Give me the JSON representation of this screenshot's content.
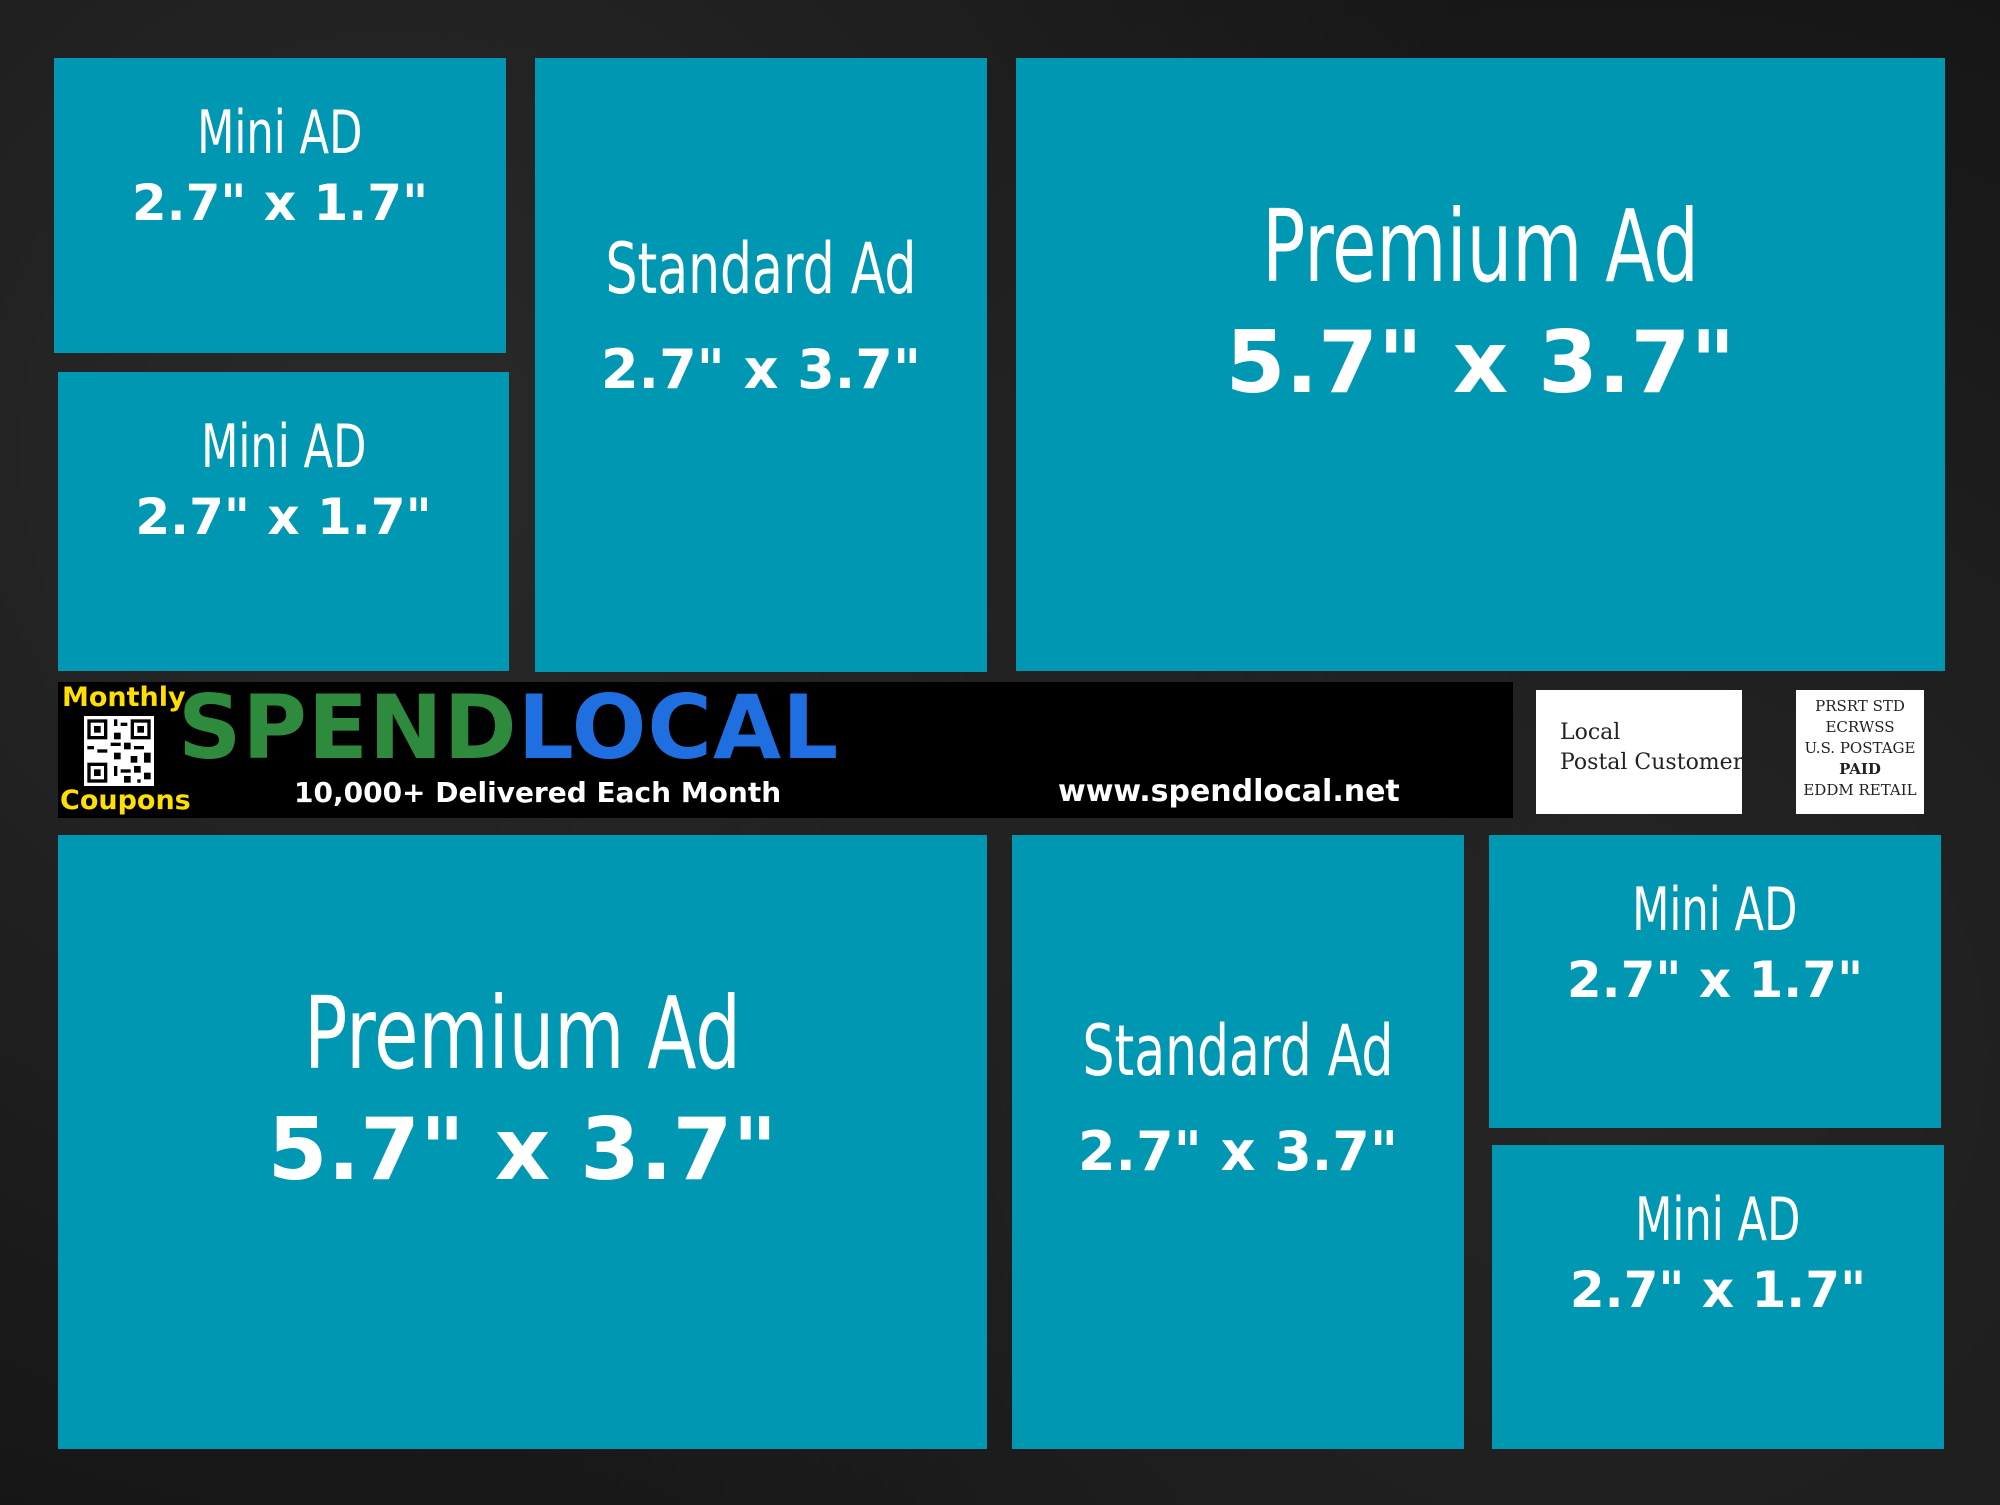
{
  "ads": {
    "mini_top_left": {
      "title": "Mini AD",
      "size": "2.7\" x 1.7\""
    },
    "mini_mid_left": {
      "title": "Mini AD",
      "size": "2.7\" x 1.7\""
    },
    "standard_top": {
      "title": "Standard Ad",
      "size": "2.7\" x 3.7\""
    },
    "premium_top": {
      "title": "Premium Ad",
      "size": "5.7\" x 3.7\""
    },
    "premium_bottom": {
      "title": "Premium Ad",
      "size": "5.7\" x 3.7\""
    },
    "standard_bottom": {
      "title": "Standard Ad",
      "size": "2.7\" x 3.7\""
    },
    "mini_bottom_right_top": {
      "title": "Mini AD",
      "size": "2.7\" x 1.7\""
    },
    "mini_bottom_right_bottom": {
      "title": "Mini AD",
      "size": "2.7\" x 1.7\""
    }
  },
  "banner": {
    "monthly": "Monthly",
    "coupons": "Coupons",
    "brand_part1": "SPEND",
    "brand_part2": "LOCAL",
    "delivered": "10,000+ Delivered Each Month",
    "url": "www.spendlocal.net",
    "qr_icon": "qr-code-icon"
  },
  "postal": {
    "line1": "Local",
    "line2": "Postal Customer"
  },
  "stamp": {
    "line1": "PRSRT STD",
    "line2": "ECRWSS",
    "line3": "U.S. POSTAGE",
    "line4": "PAID",
    "line5": "EDDM RETAIL"
  },
  "colors": {
    "ad_block": "#0097b2",
    "brand_green": "#2e8b3e",
    "brand_blue": "#1f6fe0",
    "yellow": "#ffde00"
  }
}
